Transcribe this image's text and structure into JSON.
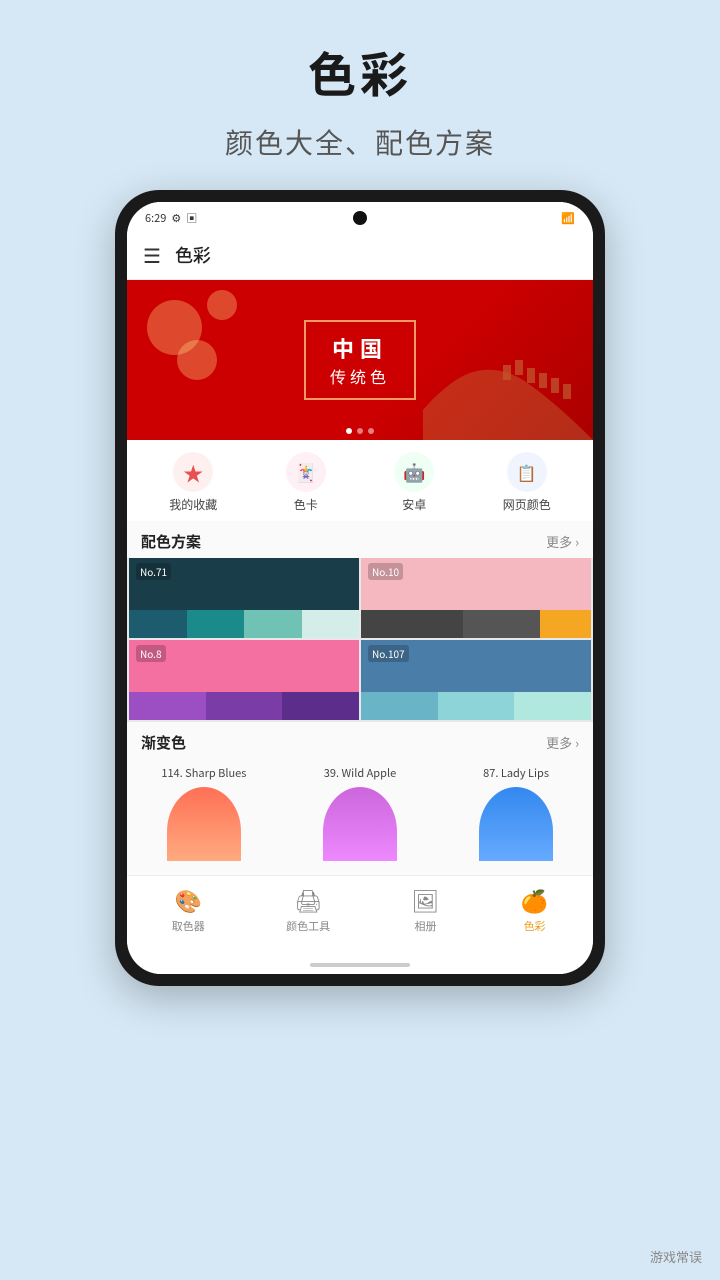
{
  "page": {
    "title": "色彩",
    "subtitle": "颜色大全、配色方案",
    "background": "#d6e8f5",
    "watermark": "游戏常误"
  },
  "status_bar": {
    "time": "6:29",
    "icons": [
      "⚙",
      "□"
    ],
    "right_icons": [
      "signal"
    ]
  },
  "app_header": {
    "title": "色彩"
  },
  "banner": {
    "main_text": "中国",
    "sub_text": "传统色",
    "dots": [
      true,
      false,
      false
    ]
  },
  "nav_icons": [
    {
      "icon": "⭐",
      "label": "我的收藏",
      "color": "#f06060"
    },
    {
      "icon": "🃏",
      "label": "色卡",
      "color": "#e06080"
    },
    {
      "icon": "🤖",
      "label": "安卓",
      "color": "#3ddc84"
    },
    {
      "icon": "📋",
      "label": "网页颜色",
      "color": "#4488cc"
    }
  ],
  "palette_section": {
    "title": "配色方案",
    "more": "更多 ›",
    "items": [
      {
        "label": "No.71",
        "top_color": "#1a3d4a",
        "swatches": [
          "#1d5c6e",
          "#1b8a8a",
          "#6fc2b4",
          "#d4ede8"
        ]
      },
      {
        "label": "No.10",
        "top_color": "#f5b8c0",
        "swatches": [
          "#444",
          "#555",
          "#f5a623"
        ]
      },
      {
        "label": "No.8",
        "top_color": "#f470a0",
        "swatches": [
          "#9b4fc2",
          "#7a3da8",
          "#5c2d8a"
        ]
      },
      {
        "label": "No.107",
        "top_color": "#4a7da8",
        "swatches": [
          "#6ab4c8",
          "#8dd4d8",
          "#b0e8e0"
        ]
      }
    ]
  },
  "gradient_section": {
    "title": "渐变色",
    "more": "更多 ›",
    "items": [
      {
        "label": "114. Sharp Blues",
        "gradient_from": "#ff7055",
        "gradient_to": "#ff9070"
      },
      {
        "label": "39. Wild Apple",
        "gradient_from": "#cc66dd",
        "gradient_to": "#bb44cc"
      },
      {
        "label": "87. Lady Lips",
        "gradient_from": "#3388ee",
        "gradient_to": "#2266cc"
      }
    ]
  },
  "bottom_tabs": [
    {
      "icon": "🎨",
      "label": "取色器",
      "active": false
    },
    {
      "icon": "🖨",
      "label": "颜色工具",
      "active": false
    },
    {
      "icon": "🖼",
      "label": "相册",
      "active": false
    },
    {
      "icon": "🍊",
      "label": "色彩",
      "active": true
    }
  ]
}
